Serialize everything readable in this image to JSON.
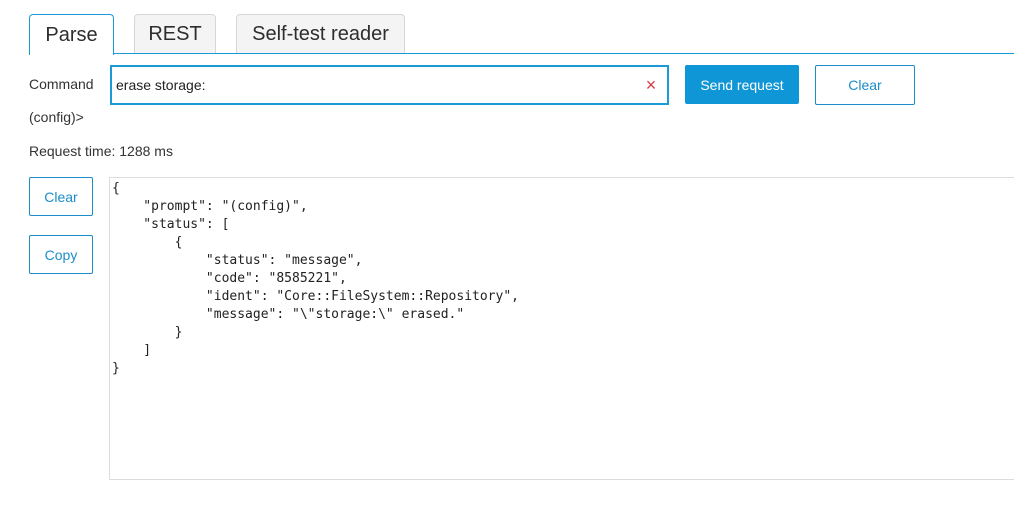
{
  "tabs": [
    {
      "label": "Parse",
      "active": true
    },
    {
      "label": "REST",
      "active": false
    },
    {
      "label": "Self-test reader",
      "active": false
    }
  ],
  "command": {
    "label": "Command",
    "value": "erase storage:",
    "clear_icon": "×",
    "send_label": "Send request",
    "clear_label": "Clear"
  },
  "prompt": "(config)>",
  "request_time": "Request time: 1288 ms",
  "side_buttons": {
    "clear_label": "Clear",
    "copy_label": "Copy"
  },
  "output": "{\n    \"prompt\": \"(config)\",\n    \"status\": [\n        {\n            \"status\": \"message\",\n            \"code\": \"8585221\",\n            \"ident\": \"Core::FileSystem::Repository\",\n            \"message\": \"\\\"storage:\\\" erased.\"\n        }\n    ]\n}",
  "colors": {
    "accent": "#1a9bd7",
    "primary_button": "#0f96d6",
    "clear_icon": "#e0393e"
  }
}
